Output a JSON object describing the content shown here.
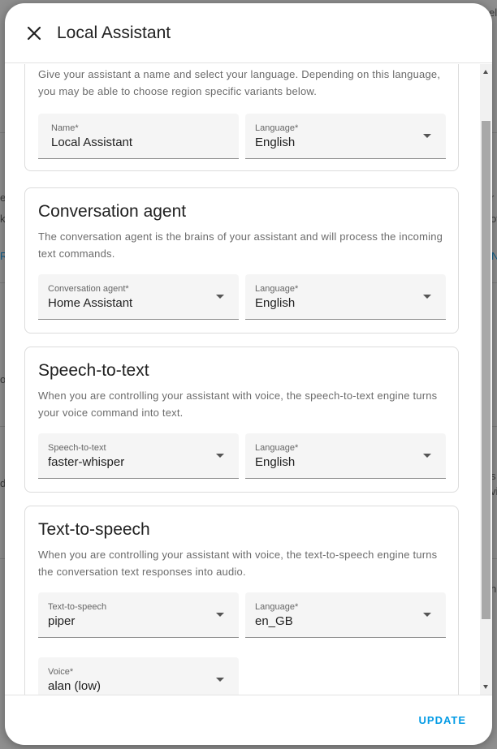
{
  "dialog": {
    "title": "Local Assistant",
    "update_label": "UPDATE"
  },
  "background": {
    "fragments": [
      "el",
      "et",
      "ke",
      "R",
      "N",
      "o",
      "d",
      "s",
      "vi",
      "n",
      "r",
      "ot"
    ]
  },
  "sections": {
    "intro": {
      "description": "Give your assistant a name and select your language. Depending on this language, you may be able to choose region specific variants below.",
      "name_field": {
        "label": "Name*",
        "value": "Local Assistant"
      },
      "language_field": {
        "label": "Language*",
        "value": "English"
      }
    },
    "conversation": {
      "title": "Conversation agent",
      "description": "The conversation agent is the brains of your assistant and will process the incoming text commands.",
      "agent_field": {
        "label": "Conversation agent*",
        "value": "Home Assistant"
      },
      "language_field": {
        "label": "Language*",
        "value": "English"
      }
    },
    "stt": {
      "title": "Speech-to-text",
      "description": "When you are controlling your assistant with voice, the speech-to-text engine turns your voice command into text.",
      "engine_field": {
        "label": "Speech-to-text",
        "value": "faster-whisper"
      },
      "language_field": {
        "label": "Language*",
        "value": "English"
      }
    },
    "tts": {
      "title": "Text-to-speech",
      "description": "When you are controlling your assistant with voice, the text-to-speech engine turns the conversation text responses into audio.",
      "engine_field": {
        "label": "Text-to-speech",
        "value": "piper"
      },
      "language_field": {
        "label": "Language*",
        "value": "en_GB"
      },
      "voice_field": {
        "label": "Voice*",
        "value": "alan (low)"
      }
    }
  },
  "colors": {
    "accent": "#039be5",
    "field_bg": "#f5f5f5",
    "card_border": "#dcdcdc"
  }
}
